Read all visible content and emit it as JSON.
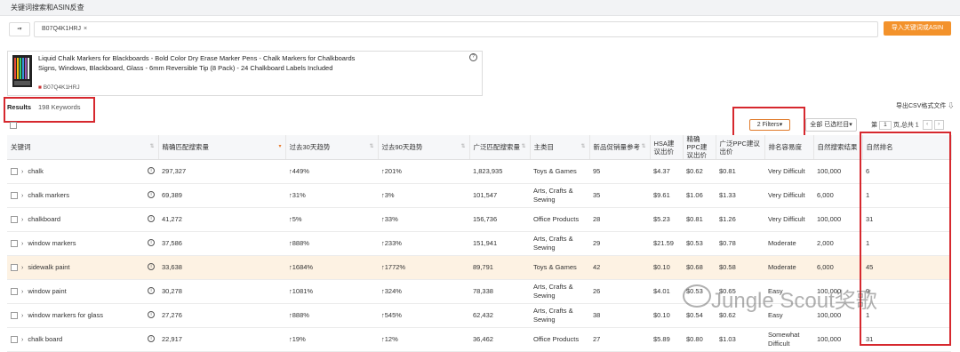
{
  "header": {
    "title": "关键词搜索和ASIN反查"
  },
  "search": {
    "asin_chip": "B07Q4K1HRJ",
    "export_button": "导入关键词或ASIN"
  },
  "product": {
    "title": "Liquid Chalk Markers for Blackboards - Bold Color Dry Erase Marker Pens - Chalk Markers for Chalkboards Signs, Windows, Blackboard, Glass - 6mm Reversible Tip (8 Pack) - 24 Chalkboard Labels Included",
    "asin": "B07Q4K1HRJ"
  },
  "results": {
    "label": "Results",
    "count": "198 Keywords"
  },
  "toolbar": {
    "export_csv": "导出CSV格式文件",
    "filters": "2 Filters",
    "columns": "全部 已选栏目",
    "pager_page": "1",
    "pager_text": "页,总共 1"
  },
  "columns": [
    "关键词",
    "精确匹配搜索量",
    "过去30天趋势",
    "过去90天趋势",
    "广泛匹配搜索量",
    "主类目",
    "新品促销量参考",
    "HSA建议出价",
    "精确PPC建议出价",
    "广泛PPC建议出价",
    "排名容易度",
    "自然搜索结果",
    "自然排名"
  ],
  "rows": [
    {
      "keyword": "chalk",
      "exact": "297,327",
      "t30": "↑449%",
      "t90": "↑201%",
      "broad": "1,823,935",
      "category": "Toys & Games",
      "promo": "95",
      "hsa": "$4.37",
      "exact_ppc": "$0.62",
      "broad_ppc": "$0.81",
      "ease": "Very Difficult",
      "organic": "100,000",
      "rank": "6"
    },
    {
      "keyword": "chalk markers",
      "exact": "69,389",
      "t30": "↑31%",
      "t90": "↑3%",
      "broad": "101,547",
      "category": "Arts, Crafts & Sewing",
      "promo": "35",
      "hsa": "$9.61",
      "exact_ppc": "$1.06",
      "broad_ppc": "$1.33",
      "ease": "Very Difficult",
      "organic": "6,000",
      "rank": "1"
    },
    {
      "keyword": "chalkboard",
      "exact": "41,272",
      "t30": "↑5%",
      "t90": "↑33%",
      "broad": "156,736",
      "category": "Office Products",
      "promo": "28",
      "hsa": "$5.23",
      "exact_ppc": "$0.81",
      "broad_ppc": "$1.26",
      "ease": "Very Difficult",
      "organic": "100,000",
      "rank": "31"
    },
    {
      "keyword": "window markers",
      "exact": "37,586",
      "t30": "↑888%",
      "t90": "↑233%",
      "broad": "151,941",
      "category": "Arts, Crafts & Sewing",
      "promo": "29",
      "hsa": "$21.59",
      "exact_ppc": "$0.53",
      "broad_ppc": "$0.78",
      "ease": "Moderate",
      "organic": "2,000",
      "rank": "1"
    },
    {
      "keyword": "sidewalk paint",
      "exact": "33,638",
      "t30": "↑1684%",
      "t90": "↑1772%",
      "broad": "89,791",
      "category": "Toys & Games",
      "promo": "42",
      "hsa": "$0.10",
      "exact_ppc": "$0.68",
      "broad_ppc": "$0.58",
      "ease": "Moderate",
      "organic": "6,000",
      "rank": "45"
    },
    {
      "keyword": "window paint",
      "exact": "30,278",
      "t30": "↑1081%",
      "t90": "↑324%",
      "broad": "78,338",
      "category": "Arts, Crafts & Sewing",
      "promo": "26",
      "hsa": "$4.01",
      "exact_ppc": "$0.53",
      "broad_ppc": "$0.65",
      "ease": "Easy",
      "organic": "100,000",
      "rank": "9"
    },
    {
      "keyword": "window markers for glass",
      "exact": "27,276",
      "t30": "↑888%",
      "t90": "↑545%",
      "broad": "62,432",
      "category": "Arts, Crafts & Sewing",
      "promo": "38",
      "hsa": "$0.10",
      "exact_ppc": "$0.54",
      "broad_ppc": "$0.62",
      "ease": "Easy",
      "organic": "100,000",
      "rank": "1"
    },
    {
      "keyword": "chalk board",
      "exact": "22,917",
      "t30": "↑19%",
      "t90": "↑12%",
      "broad": "36,462",
      "category": "Office Products",
      "promo": "27",
      "hsa": "$5.89",
      "exact_ppc": "$0.80",
      "broad_ppc": "$1.03",
      "ease": "Somewhat Difficult",
      "organic": "100,000",
      "rank": "31"
    }
  ],
  "watermark": "Jungle Scout奖歌",
  "colors": {
    "accent": "#f3922b",
    "highlight": "#d6282e",
    "trend_up": "#3b9d3b",
    "volume": "#e5821f"
  }
}
